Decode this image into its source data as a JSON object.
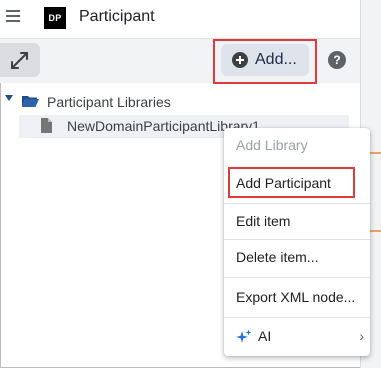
{
  "header": {
    "logo_text": "DP",
    "title": "Participant"
  },
  "toolbar": {
    "add_label": "Add...",
    "help_glyph": "?"
  },
  "tree": {
    "root_label": "Participant Libraries",
    "child_label": "NewDomainParticipantLibrary1"
  },
  "context_menu": {
    "add_library": "Add Library",
    "add_participant": "Add Participant",
    "edit_item": "Edit item",
    "delete_item": "Delete item...",
    "export_xml": "Export XML node...",
    "ai": "AI",
    "ai_chevron": "›"
  },
  "colors": {
    "highlight": "#e0393e",
    "folder": "#1f4e8c",
    "ai_icon": "#1a73e8",
    "accent_tick": "#e8a35a"
  },
  "icons": [
    "menu-icon",
    "expand-icon",
    "add-circle-icon",
    "help-icon",
    "caret-down-icon",
    "folder-open-icon",
    "document-icon",
    "sparkle-icon",
    "chevron-right-icon"
  ]
}
